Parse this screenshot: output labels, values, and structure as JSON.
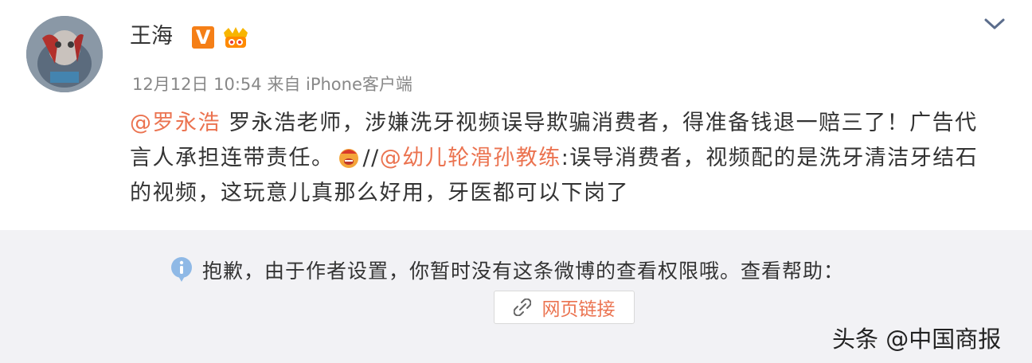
{
  "post": {
    "author_name": "王海",
    "vip_badge": "V",
    "meta": {
      "timestamp": "12月12日 10:54",
      "source": "来自 iPhone客户端"
    },
    "body": {
      "mention1": "@罗永浩",
      "text1": " 罗永浩老师，涉嫌洗牙视频误导欺骗消费者，得准备钱退一赔三了！广告代言人承担连带责任。",
      "separator": "//",
      "mention2": "@幼儿轮滑孙教练",
      "text2": ":误导消费者，视频配的是洗牙清洁牙结石的视频，这玩意儿真那么好用，牙医都可以下岗了"
    }
  },
  "repost": {
    "notice": "抱歉，由于作者设置，你暂时没有这条微博的查看权限哦。查看帮助：",
    "link_label": "网页链接"
  },
  "watermark": "头条 @中国商报",
  "icons": [
    "avatar",
    "vip-badge",
    "fan-badge-icon",
    "chevron-down-icon",
    "emoji-icon",
    "info-icon",
    "link-icon"
  ],
  "colors": {
    "mention": "#eb7350",
    "vip_badge": "#f57f17",
    "repost_bg": "#f2f2f5",
    "info_icon": "#8fb9e6",
    "meta_text": "#888888"
  }
}
